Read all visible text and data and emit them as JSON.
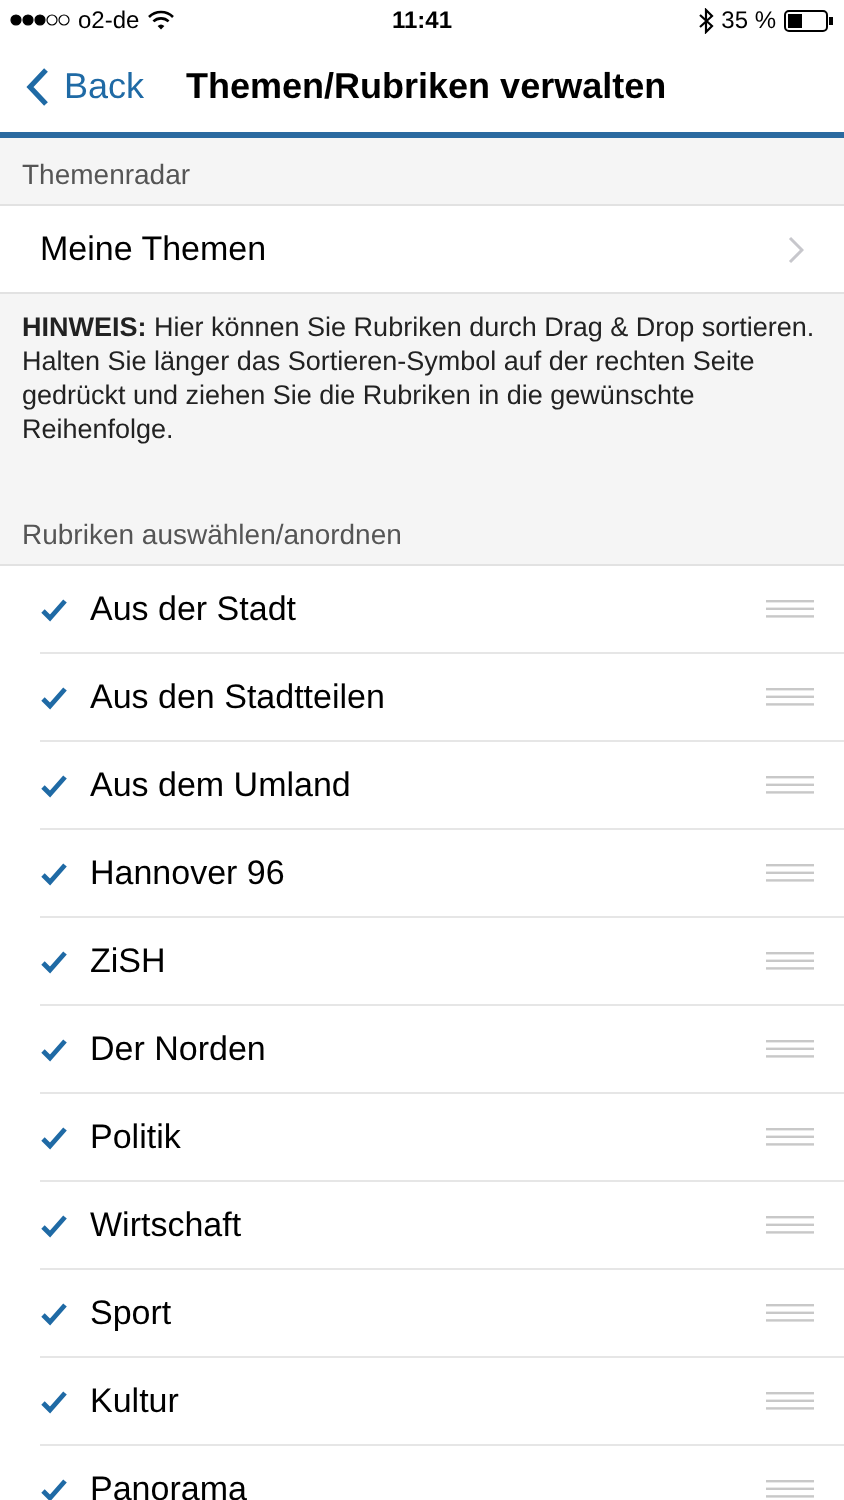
{
  "status_bar": {
    "carrier": "o2-de",
    "time": "11:41",
    "battery": "35 %"
  },
  "nav": {
    "back": "Back",
    "title": "Themen/Rubriken verwalten"
  },
  "section_1": {
    "header": "Themenradar",
    "row": "Meine Themen"
  },
  "hint": "**HINWEIS:** Hier können Sie Rubriken durch Drag & Drop sortieren. Halten Sie länger das Sortieren-Symbol auf der rechten Seite gedrückt und ziehen Sie die Rubriken in die gewünschte Reihenfolge.",
  "section_2": {
    "header": "Rubriken auswählen/anordnen",
    "items": [
      {
        "label": "Aus der Stadt",
        "checked": true
      },
      {
        "label": "Aus den Stadtteilen",
        "checked": true
      },
      {
        "label": "Aus dem Umland",
        "checked": true
      },
      {
        "label": "Hannover 96",
        "checked": true
      },
      {
        "label": "ZiSH",
        "checked": true
      },
      {
        "label": "Der Norden",
        "checked": true
      },
      {
        "label": "Politik",
        "checked": true
      },
      {
        "label": "Wirtschaft",
        "checked": true
      },
      {
        "label": "Sport",
        "checked": true
      },
      {
        "label": "Kultur",
        "checked": true
      },
      {
        "label": "Panorama",
        "checked": true
      }
    ]
  }
}
